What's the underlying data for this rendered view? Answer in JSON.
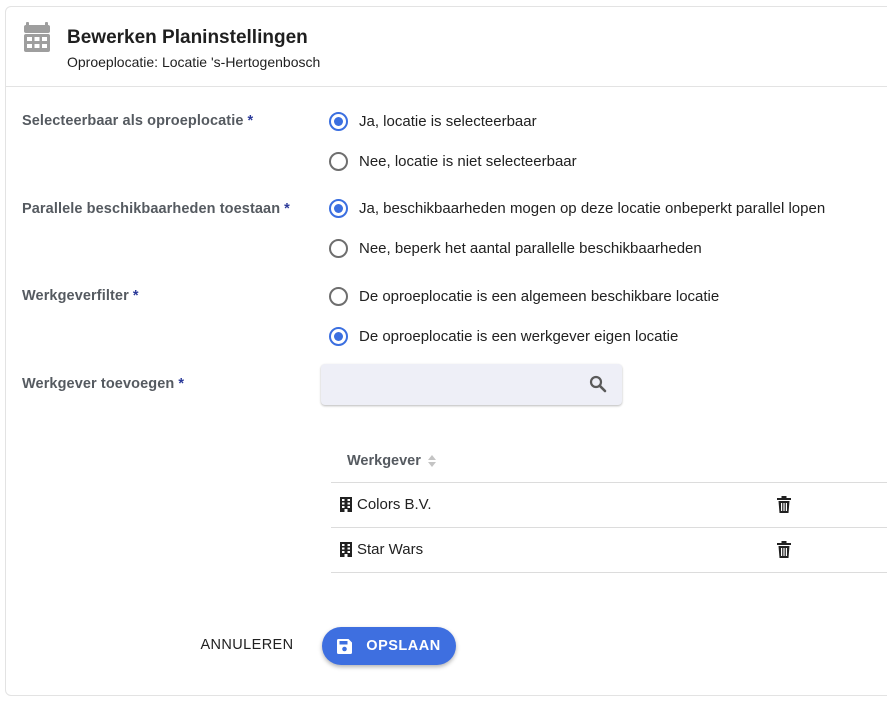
{
  "header": {
    "title": "Bewerken Planinstellingen",
    "subtitle": "Oproeplocatie: Locatie 's-Hertogenbosch",
    "icon": "calendar-icon"
  },
  "form": {
    "required_marker": "*",
    "selectable": {
      "label": "Selecteerbaar als oproeplocatie",
      "options": [
        {
          "label": "Ja, locatie is selecteerbaar",
          "checked": true
        },
        {
          "label": "Nee, locatie is niet selecteerbaar",
          "checked": false
        }
      ]
    },
    "parallel": {
      "label": "Parallele beschikbaarheden toestaan",
      "options": [
        {
          "label": "Ja, beschikbaarheden mogen op deze locatie onbeperkt parallel lopen",
          "checked": true
        },
        {
          "label": "Nee, beperk het aantal parallelle beschikbaarheden",
          "checked": false
        }
      ]
    },
    "employer_filter": {
      "label": "Werkgeverfilter",
      "options": [
        {
          "label": "De oproeplocatie is een algemeen beschikbare locatie",
          "checked": false
        },
        {
          "label": "De oproeplocatie is een werkgever eigen locatie",
          "checked": true
        }
      ]
    },
    "add_employer": {
      "label": "Werkgever toevoegen",
      "value": "",
      "placeholder": ""
    }
  },
  "table": {
    "column_header": "Werkgever",
    "rows": [
      {
        "name": "Colors B.V."
      },
      {
        "name": "Star Wars"
      }
    ]
  },
  "actions": {
    "cancel_label": "ANNULEREN",
    "save_label": "OPSLAAN"
  },
  "colors": {
    "accent": "#3e6fe0",
    "label_text": "#555a60",
    "required": "#2b3a99"
  }
}
